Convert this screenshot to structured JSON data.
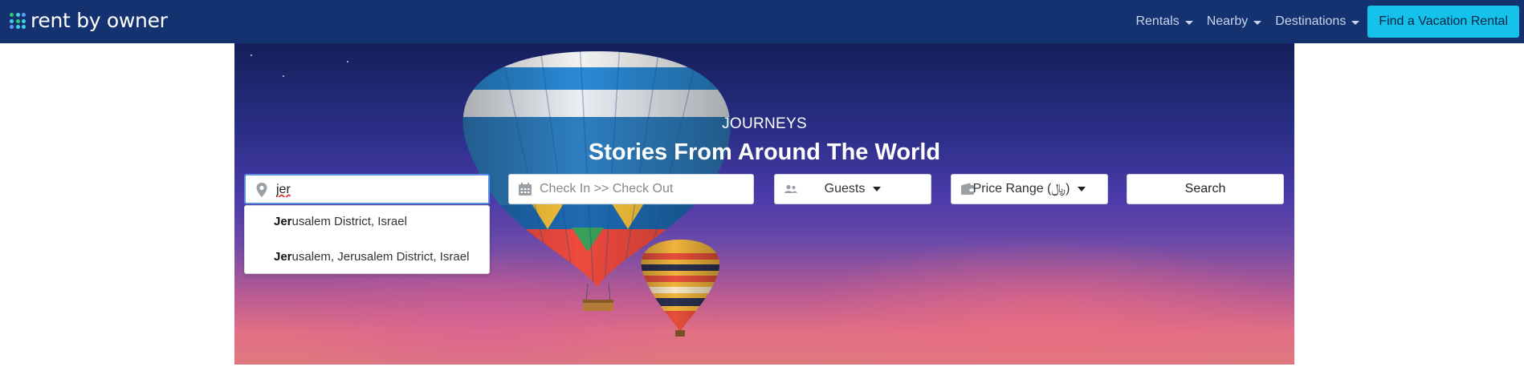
{
  "brand": {
    "name": "rent by owner"
  },
  "nav": {
    "items": [
      {
        "label": "Rentals"
      },
      {
        "label": "Nearby"
      },
      {
        "label": "Destinations"
      }
    ],
    "cta_label": "Find a Vacation Rental"
  },
  "hero": {
    "kicker": "JOURNEYS",
    "headline": "Stories From Around The World"
  },
  "search": {
    "location_value": "jer",
    "dates_placeholder": "Check In >> Check Out",
    "guests_label": "Guests",
    "price_label": "Price Range (﷼)",
    "search_label": "Search"
  },
  "suggestions": [
    {
      "match": "Jer",
      "rest": "usalem District, Israel"
    },
    {
      "match": "Jer",
      "rest": "usalem, Jerusalem District, Israel"
    }
  ],
  "colors": {
    "navbar": "#14326f",
    "cta": "#15c2ea",
    "focus_border": "#5b8ee6"
  }
}
